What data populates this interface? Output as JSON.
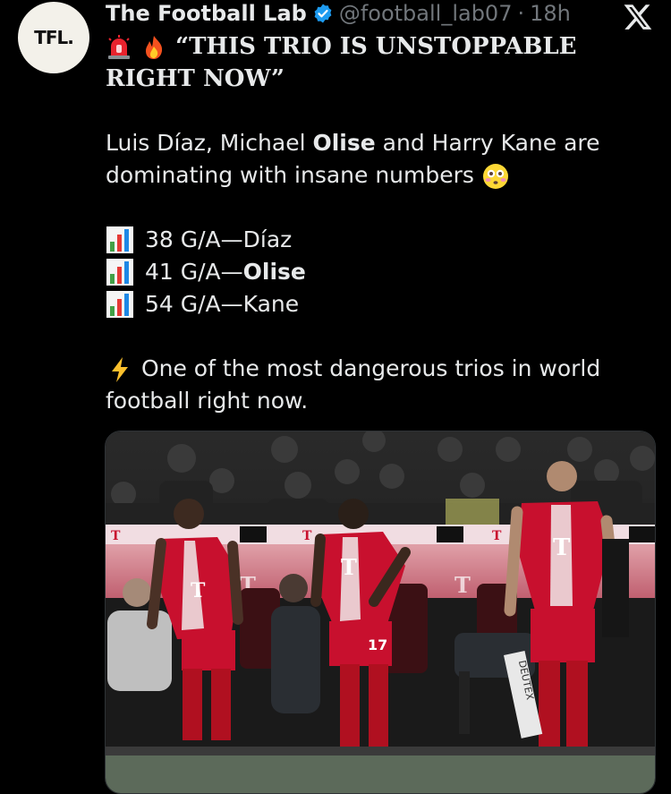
{
  "tweet": {
    "avatar_text": "TFL.",
    "display_name": "The Football Lab",
    "handle": "@football_lab07",
    "separator": "·",
    "time": "18h",
    "headline": "“THIS TRIO IS UNSTOPPABLE RIGHT NOW”",
    "intro_part1": "Luis Díaz, Michael ",
    "intro_bold": "Olise",
    "intro_part2": " and Harry Kane are dominating with insane numbers",
    "stats": [
      {
        "value": "38 G/A",
        "dash": " — ",
        "player": "Díaz",
        "bold": false
      },
      {
        "value": "41 G/A",
        "dash": " — ",
        "player": "Olise",
        "bold": true
      },
      {
        "value": "54 G/A",
        "dash": " — ",
        "player": "Kane",
        "bold": false
      }
    ],
    "closing": "One of the most dangerous trios in world football right now.",
    "photo": {
      "board_letter": "T",
      "shirt_number": "17",
      "sign_text": "DEUTEX"
    }
  },
  "colors": {
    "background": "#000000",
    "text": "#e7e9ea",
    "muted": "#71767b",
    "verified": "#1d9bf0",
    "kit_red": "#c8102e"
  },
  "icons": [
    "verified-badge-icon",
    "x-logo-icon",
    "siren-emoji-icon",
    "fire-emoji-icon",
    "flushed-face-emoji-icon",
    "bar-chart-emoji-icon",
    "lightning-emoji-icon"
  ]
}
